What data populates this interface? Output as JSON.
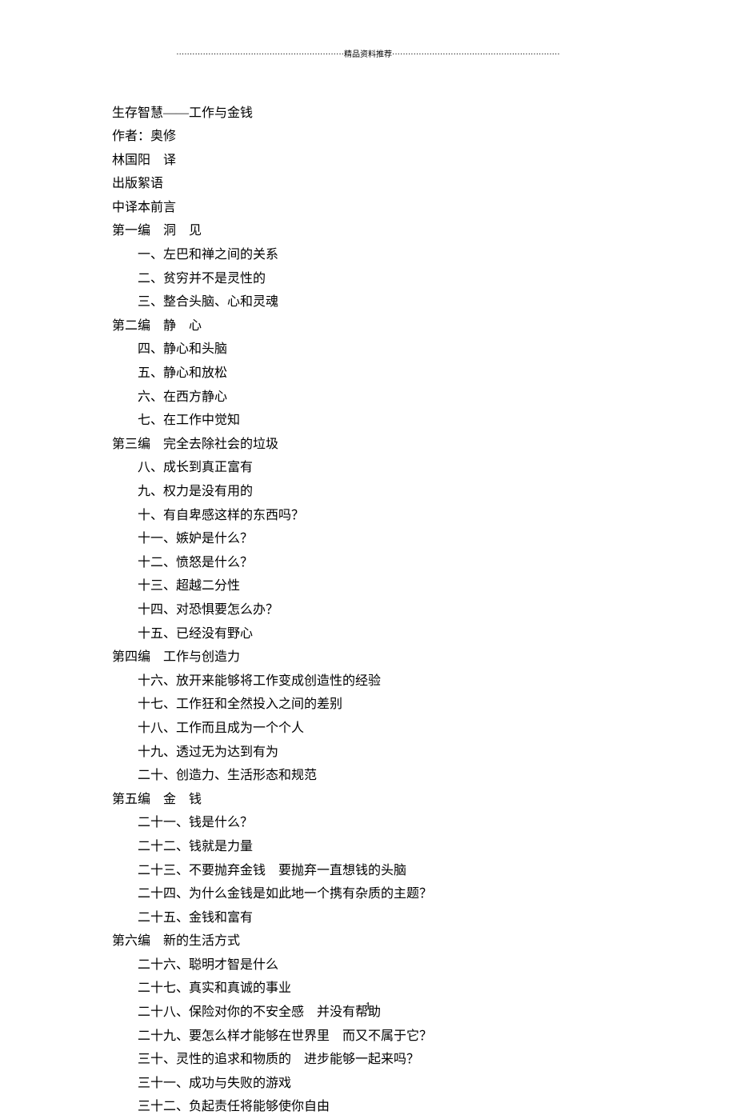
{
  "header_banner": "·······························································精品资料推荐·······························································",
  "title": "生存智慧——工作与金钱",
  "author_line": "作者：奥修",
  "translator_line": "林国阳　译",
  "pub_note": "出版絮语",
  "preface": "中译本前言",
  "sections": [
    {
      "heading": "第一编　洞　见",
      "items": [
        "一、左巴和禅之间的关系",
        "二、贫穷并不是灵性的",
        "三、整合头脑、心和灵魂"
      ]
    },
    {
      "heading": "第二编　静　心",
      "items": [
        "四、静心和头脑",
        "五、静心和放松",
        "六、在西方静心",
        "七、在工作中觉知"
      ]
    },
    {
      "heading": "第三编　完全去除社会的垃圾",
      "items": [
        "八、成长到真正富有",
        "九、权力是没有用的",
        "十、有自卑感这样的东西吗？",
        "十一、嫉妒是什么？",
        "十二、愤怒是什么？",
        "十三、超越二分性",
        "十四、对恐惧要怎么办？",
        "十五、已经没有野心"
      ]
    },
    {
      "heading": "第四编　工作与创造力",
      "items": [
        "十六、放开来能够将工作变成创造性的经验",
        "十七、工作狂和全然投入之间的差别",
        "十八、工作而且成为一个个人",
        "十九、透过无为达到有为",
        "二十、创造力、生活形态和规范"
      ]
    },
    {
      "heading": "第五编　金　钱",
      "items": [
        "二十一、钱是什么？",
        "二十二、钱就是力量",
        "二十三、不要抛弃金钱　要抛弃一直想钱的头脑",
        "二十四、为什么金钱是如此地一个携有杂质的主题？",
        "二十五、金钱和富有"
      ]
    },
    {
      "heading": "第六编　新的生活方式",
      "items": [
        "二十六、聪明才智是什么",
        "二十七、真实和真诚的事业",
        "二十八、保险对你的不安全感　并没有帮助",
        "二十九、要怎么样才能够在世界里　而又不属于它？",
        "三十、灵性的追求和物质的　进步能够一起来吗？",
        "三十一、成功与失败的游戏",
        "三十二、负起责任将能够使你自由"
      ]
    }
  ],
  "page_number": "1"
}
